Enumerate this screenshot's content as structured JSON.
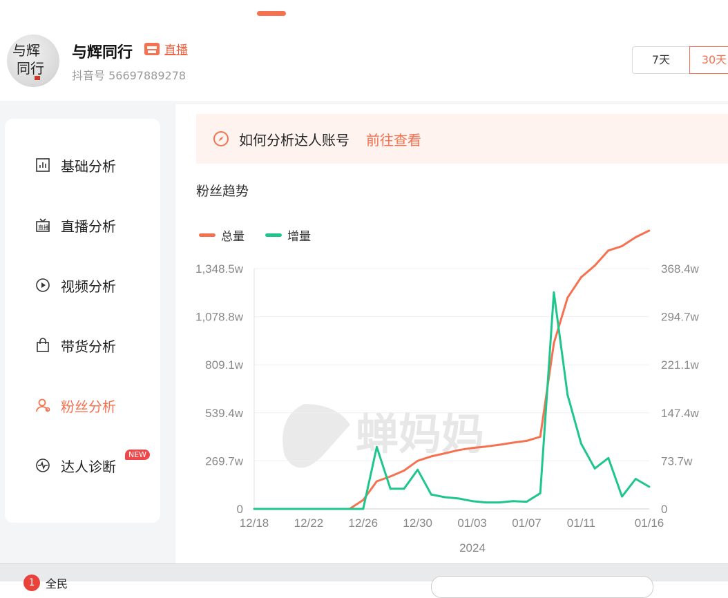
{
  "account": {
    "name": "与辉同行",
    "live_label": "直播",
    "douyin_id": "抖音号 56697889278",
    "avatar_text": "与辉同行"
  },
  "range_buttons": [
    "7天",
    "30天"
  ],
  "sidebar": {
    "items": [
      {
        "label": "基础分析",
        "icon": "bar-chart-icon"
      },
      {
        "label": "直播分析",
        "icon": "live-tv-icon"
      },
      {
        "label": "视频分析",
        "icon": "play-circle-icon"
      },
      {
        "label": "带货分析",
        "icon": "shopping-bag-icon"
      },
      {
        "label": "粉丝分析",
        "icon": "user-icon"
      },
      {
        "label": "达人诊断",
        "icon": "pulse-icon"
      }
    ],
    "active_index": 4,
    "new_badge": "NEW"
  },
  "tip": {
    "text": "如何分析达人账号",
    "link": "前往查看",
    "icon": "compass-icon"
  },
  "section_title": "粉丝趋势",
  "watermark": "蝉妈妈",
  "bottom": {
    "badge": "1",
    "label": "全民"
  },
  "colors": {
    "accent": "#f5714f",
    "total": "#f5714f",
    "increment": "#1fc68c",
    "tip_bg": "#fff3ef"
  },
  "chart_data": {
    "type": "line",
    "x": [
      "12/18",
      "12/19",
      "12/20",
      "12/21",
      "12/22",
      "12/23",
      "12/24",
      "12/25",
      "12/26",
      "12/27",
      "12/28",
      "12/29",
      "12/30",
      "12/31",
      "01/01",
      "01/02",
      "01/03",
      "01/04",
      "01/05",
      "01/06",
      "01/07",
      "01/08",
      "01/09",
      "01/10",
      "01/11",
      "01/12",
      "01/13",
      "01/14",
      "01/15",
      "01/16"
    ],
    "x_tick_labels": [
      "12/18",
      "12/22",
      "12/26",
      "12/30",
      "01/03",
      "01/07",
      "01/11",
      "01/16"
    ],
    "xlabel": "2024",
    "series": [
      {
        "name": "总量",
        "axis": "left",
        "values": [
          0,
          0,
          0,
          0,
          0,
          0,
          0,
          0,
          50,
          155,
          182,
          215,
          270,
          295,
          312,
          330,
          342,
          350,
          360,
          372,
          382,
          405,
          930,
          1185,
          1300,
          1365,
          1450,
          1475,
          1525,
          1562
        ]
      },
      {
        "name": "增量",
        "axis": "right",
        "values": [
          0,
          0,
          0,
          0,
          0,
          0,
          0,
          0,
          0,
          95,
          31,
          31,
          60,
          22,
          18,
          16,
          12,
          10,
          10,
          12,
          11,
          24,
          332,
          175,
          100,
          62,
          78,
          19,
          46,
          34
        ]
      }
    ],
    "y_left": {
      "ticks": [
        "0",
        "269.7w",
        "539.4w",
        "809.1w",
        "1,078.8w",
        "1,348.5w"
      ],
      "ylim": [
        0,
        1348.5
      ]
    },
    "y_right": {
      "ticks": [
        "0",
        "73.7w",
        "147.4w",
        "221.1w",
        "294.7w",
        "368.4w"
      ],
      "ylim": [
        0,
        368.4
      ]
    },
    "grid": true,
    "legend_position": "top-left"
  }
}
